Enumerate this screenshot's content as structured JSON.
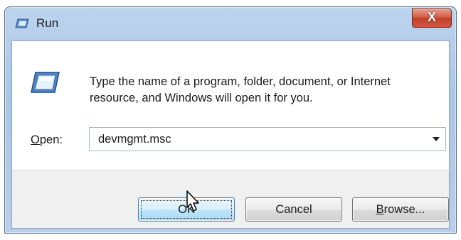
{
  "window": {
    "title": "Run",
    "close_label": "X"
  },
  "dialog": {
    "description": "Type the name of a program, folder, document, or Internet resource, and Windows will open it for you.",
    "open_label_accel": "O",
    "open_label_rest": "pen:",
    "open_value": "devmgmt.msc"
  },
  "buttons": {
    "ok": "OK",
    "cancel": "Cancel",
    "browse_accel": "B",
    "browse_rest": "rowse..."
  },
  "icons": {
    "title": "run-icon",
    "body": "run-icon",
    "dropdown": "chevron-down-icon",
    "cursor": "mouse-pointer-icon"
  },
  "colors": {
    "titlebar": "#b8cfe9",
    "close": "#c0412a",
    "ok_button": "#bee6fd",
    "footer": "#f0f0f0"
  }
}
